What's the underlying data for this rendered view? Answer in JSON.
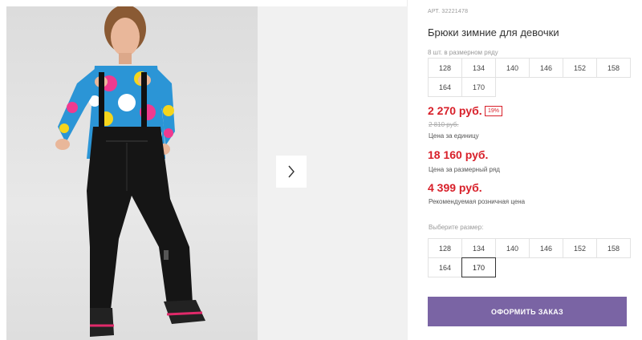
{
  "product": {
    "article": "АРТ. 32221478",
    "title": "Брюки зимние для девочки"
  },
  "size_row": {
    "label": "8 шт. в размерном ряду",
    "sizes": [
      "128",
      "134",
      "140",
      "146",
      "152",
      "158",
      "164",
      "170"
    ]
  },
  "prices": {
    "unit_price": "2 270 руб.",
    "discount": "19%",
    "old_price": "2 810 руб.",
    "unit_label": "Цена за единицу",
    "row_price": "18 160 руб.",
    "row_label": "Цена за размерный ряд",
    "rrp_price": "4 399 руб.",
    "rrp_label": "Рекомендуемая розничная цена",
    "accent_color": "#d8202a"
  },
  "size_select": {
    "label": "Выберите размер:",
    "sizes": [
      "128",
      "134",
      "140",
      "146",
      "152",
      "158",
      "164",
      "170"
    ],
    "selected": "170"
  },
  "order": {
    "button_label": "ОФОРМИТЬ ЗАКАЗ",
    "button_color": "#7a64a4"
  },
  "gallery": {
    "next_icon": "chevron-right-icon"
  }
}
